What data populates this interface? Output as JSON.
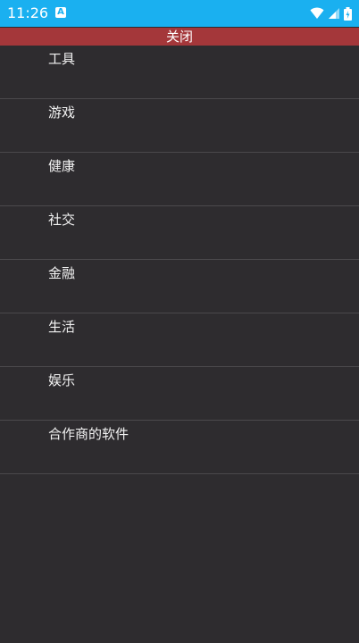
{
  "status_bar": {
    "time": "11:26",
    "notification_icon": "A",
    "icons": [
      "wifi-icon",
      "signal-icon",
      "battery-icon"
    ],
    "background": "#1ab0f0"
  },
  "close_bar": {
    "label": "关闭",
    "background": "#a4373a"
  },
  "categories": [
    {
      "label": "工具"
    },
    {
      "label": "游戏"
    },
    {
      "label": "健康"
    },
    {
      "label": "社交"
    },
    {
      "label": "金融"
    },
    {
      "label": "生活"
    },
    {
      "label": "娱乐"
    },
    {
      "label": "合作商的软件"
    }
  ],
  "theme": {
    "background": "#2e2c2f",
    "divider": "#4b494c",
    "text": "#f2f2f2"
  }
}
